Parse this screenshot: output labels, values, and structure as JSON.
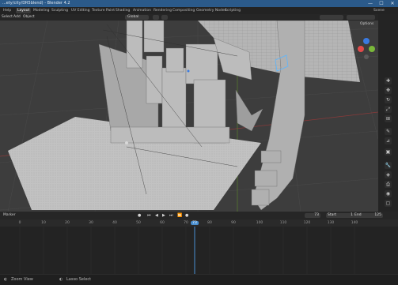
{
  "window": {
    "title": "...ety/city/DR5blend) - Blender 4.2",
    "controls": [
      "—",
      "☐",
      "✕"
    ]
  },
  "menubar": {
    "menus": [
      "Help"
    ],
    "workspaces": [
      "Layout",
      "Modeling",
      "Sculpting",
      "UV Editing",
      "Texture Paint",
      "Shading",
      "Animation",
      "Rendering",
      "Compositing",
      "Geometry Nodes",
      "Scripting"
    ],
    "active_workspace": "Layout",
    "scene_name": "Scene"
  },
  "viewport_header": {
    "menus": [
      "Select",
      "Add",
      "Object"
    ],
    "transform_orientation": "Global",
    "options_label": "Options"
  },
  "viewport": {
    "background": "#3d3d3d",
    "grid_color": "#4a4a4a",
    "mesh_color": "#b8b8b8",
    "x_axis_color": "#8a3a3a",
    "y_axis_color": "#5f8a2a"
  },
  "nav_gizmo": {
    "x_color": "#e14a4a",
    "y_color": "#7ab83a",
    "z_color": "#3a7ae1"
  },
  "side_tools": {
    "icons": [
      "cursor-icon",
      "move-icon",
      "rotate-icon",
      "scale-icon",
      "transform-icon",
      "annotate-icon",
      "measure-icon",
      "add-cube-icon"
    ],
    "properties_icons": [
      "tool-icon",
      "render-icon",
      "output-icon",
      "view-layer-icon",
      "scene-icon",
      "world-icon",
      "object-icon",
      "modifier-icon",
      "particles-icon",
      "physics-icon",
      "constraints-icon",
      "data-icon"
    ]
  },
  "timeline": {
    "menu": "Marker",
    "current_frame": "73",
    "start_label": "Start",
    "start_value": "1",
    "end_label": "End",
    "end_value": "125",
    "ticks": [
      "0",
      "10",
      "20",
      "30",
      "40",
      "50",
      "60",
      "70",
      "73",
      "80",
      "90",
      "100",
      "110",
      "120",
      "130",
      "140"
    ],
    "current_frame_marker": "73",
    "accent_color": "#4a8fd0"
  },
  "statusbar": {
    "left_hint": "Zoom View",
    "middle_hint": "Lasso Select"
  }
}
